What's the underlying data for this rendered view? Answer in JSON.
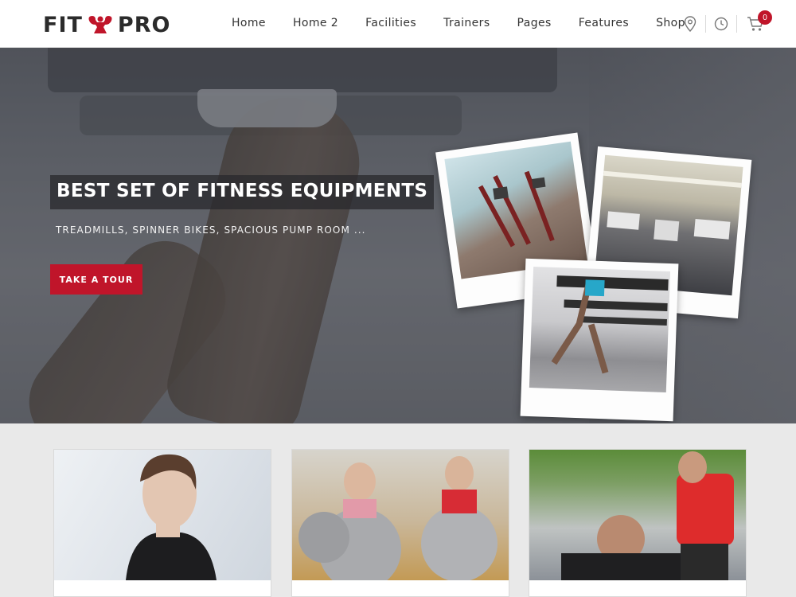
{
  "brand": {
    "left": "FIT",
    "right": "PRO"
  },
  "nav": {
    "items": [
      "Home",
      "Home 2",
      "Facilities",
      "Trainers",
      "Pages",
      "Features",
      "Shop"
    ]
  },
  "header_icons": {
    "location": "location-pin-icon",
    "hours": "clock-icon",
    "cart": "cart-icon",
    "cart_count": "0"
  },
  "hero": {
    "title": "BEST SET OF FITNESS EQUIPMENTS",
    "subtitle": "TREADMILLS, SPINNER BIKES, SPACIOUS PUMP ROOM ...",
    "button": "TAKE A TOUR"
  },
  "colors": {
    "accent": "#c0152a",
    "header_bg": "#ffffff",
    "page_bg": "#e9e9e9",
    "text_dark": "#2b2b2b"
  }
}
